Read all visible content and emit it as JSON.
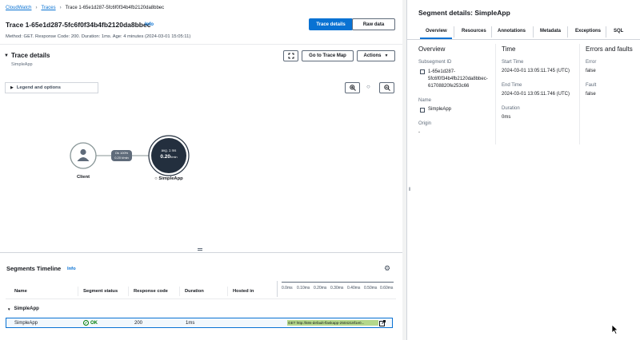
{
  "breadcrumb": {
    "root": "CloudWatch",
    "traces": "Traces",
    "current": "Trace 1-65e1d287-5fc6f0f34b4fb2120da8bbec"
  },
  "header": {
    "title": "Trace 1-65e1d287-5fc6f0f34b4fb2120da8bbec",
    "info": "Info",
    "meta": "Method: GET. Response Code: 200. Duration: 1ms. Age: 4 minutes (2024-03-01 15:05:11)",
    "btn_trace_details": "Trace details",
    "btn_raw_data": "Raw data"
  },
  "trace_details": {
    "title": "Trace details",
    "subtitle": "SimpleApp",
    "go_to_trace_map": "Go to Trace Map",
    "actions": "Actions",
    "legend": "Legend and options"
  },
  "map": {
    "client_label": "Client",
    "edge_line1": "Ok 100%",
    "edge_line2": "0.20 t/min",
    "node_line1": "avg. 1 ms",
    "node_line2": "0.20",
    "node_line2_unit": "t/min",
    "node_label": "SimpleApp"
  },
  "segments": {
    "title": "Segments Timeline",
    "info": "Info",
    "columns": [
      "Name",
      "Segment status",
      "Response code",
      "Duration",
      "Hosted in"
    ],
    "ticks": [
      "0.0ms",
      "0.10ms",
      "0.20ms",
      "0.30ms",
      "0.40ms",
      "0.50ms",
      "0.60ms"
    ],
    "group": "SimpleApp",
    "row": {
      "name": "SimpleApp",
      "status": "OK",
      "code": "200",
      "duration": "1ms",
      "bar_label": "GET http://k8s-default-flaskapp-2504218f1e0..."
    }
  },
  "panel": {
    "title": "Segment details: SimpleApp",
    "tabs": [
      "Overview",
      "Resources",
      "Annotations",
      "Metadata",
      "Exceptions",
      "SQL"
    ],
    "overview": {
      "heading": "Overview",
      "subsegment_label": "Subsegment ID",
      "subsegment_value_1": "1-65e1d287-",
      "subsegment_value_2": "5fc6f0f34b4fb2120da8bbec-",
      "subsegment_value_3": "61708820fe253c66",
      "name_label": "Name",
      "name_value": "SimpleApp",
      "origin_label": "Origin",
      "origin_value": "-"
    },
    "time": {
      "heading": "Time",
      "start_label": "Start Time",
      "start_value": "2024-03-01 13:05:11.745 (UTC)",
      "end_label": "End Time",
      "end_value": "2024-03-01 13:05:11.746 (UTC)",
      "duration_label": "Duration",
      "duration_value": "0ms"
    },
    "errors": {
      "heading": "Errors and faults",
      "error_label": "Error",
      "error_value": "false",
      "fault_label": "Fault",
      "fault_value": "false"
    }
  },
  "colors": {
    "accent": "#0972d3",
    "ok": "#037f0c",
    "node": "#232f3e"
  }
}
